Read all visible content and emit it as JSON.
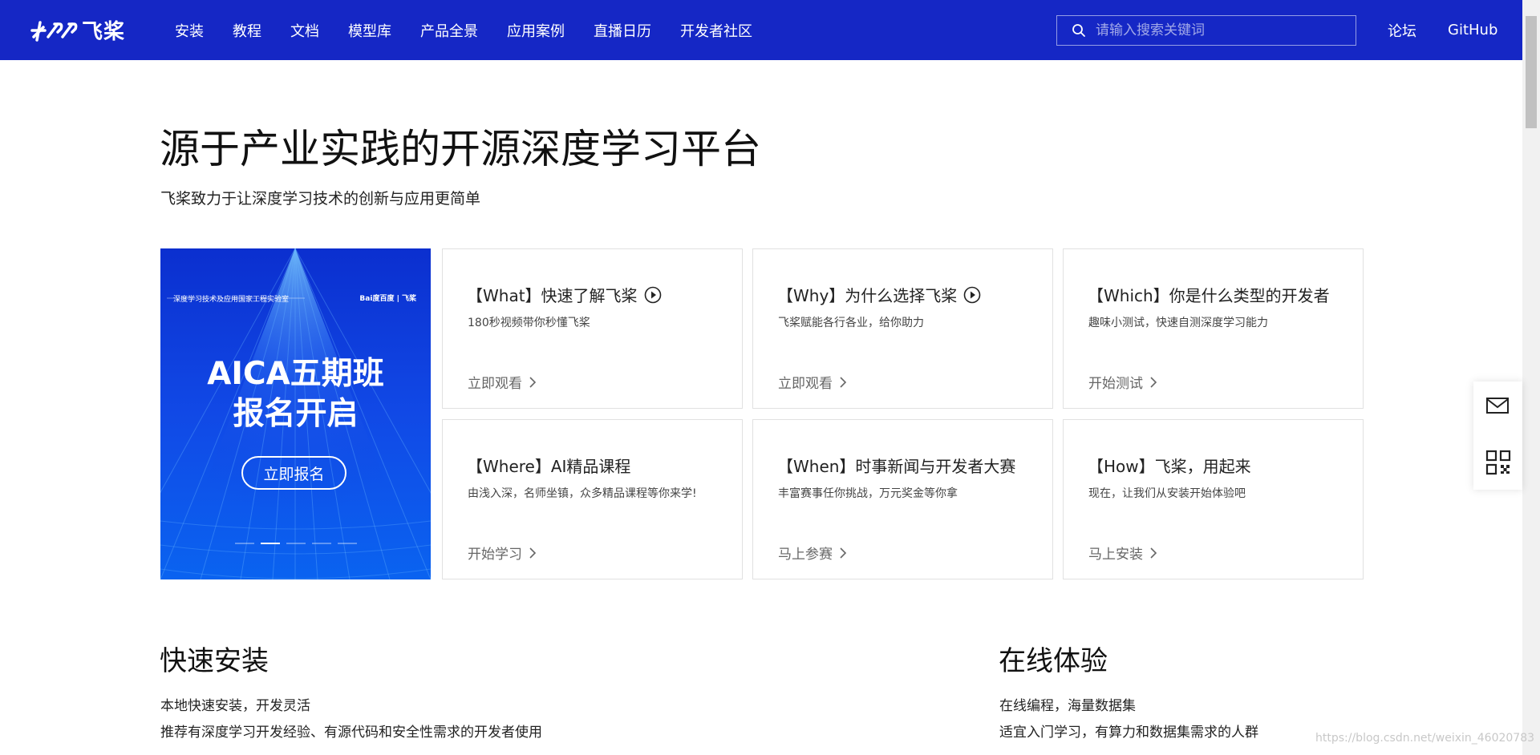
{
  "header": {
    "logo_text": "飞桨",
    "nav": [
      "安装",
      "教程",
      "文档",
      "模型库",
      "产品全景",
      "应用案例",
      "直播日历",
      "开发者社区"
    ],
    "search_placeholder": "请输入搜索关键词",
    "forum": "论坛",
    "github": "GitHub",
    "bg_color": "#1527c5"
  },
  "hero": {
    "title": "源于产业实践的开源深度学习平台",
    "subtitle": "飞桨致力于让深度学习技术的创新与应用更简单"
  },
  "banner": {
    "org": "深度学习技术及应用国家工程实验室",
    "logos": "Bai度百度 | 飞桨",
    "line1": "AICA五期班",
    "line2": "报名开启",
    "button": "立即报名",
    "active_slide": 2,
    "slide_count": 5
  },
  "cards": [
    {
      "title": "【What】快速了解飞桨",
      "play_icon": true,
      "desc": "180秒视频带你秒懂飞桨",
      "link": "立即观看"
    },
    {
      "title": "【Why】为什么选择飞桨",
      "play_icon": true,
      "desc": "飞桨赋能各行各业，给你助力",
      "link": "立即观看"
    },
    {
      "title": "【Which】你是什么类型的开发者",
      "play_icon": false,
      "desc": "趣味小测试，快速自测深度学习能力",
      "link": "开始测试"
    },
    {
      "title": "【Where】AI精品课程",
      "play_icon": false,
      "desc": "由浅入深，名师坐镇，众多精品课程等你来学!",
      "link": "开始学习"
    },
    {
      "title": "【When】时事新闻与开发者大赛",
      "play_icon": false,
      "desc": "丰富赛事任你挑战，万元奖金等你拿",
      "link": "马上参赛"
    },
    {
      "title": "【How】飞桨，用起来",
      "play_icon": false,
      "desc": "现在，让我们从安装开始体验吧",
      "link": "马上安装"
    }
  ],
  "install": {
    "title": "快速安装",
    "line1": "本地快速安装，开发灵活",
    "line2": "推荐有深度学习开发经验、有源代码和安全性需求的开发者使用"
  },
  "online": {
    "title": "在线体验",
    "line1": "在线编程，海量数据集",
    "line2": "适宜入门学习，有算力和数据集需求的人群"
  },
  "watermark": "https://blog.csdn.net/weixin_46020783"
}
